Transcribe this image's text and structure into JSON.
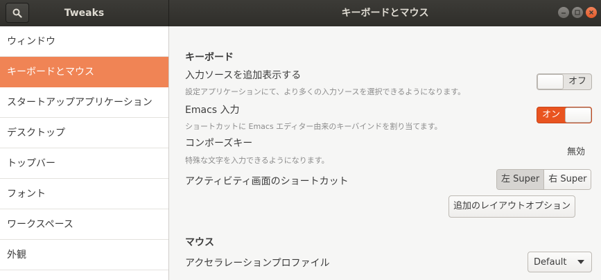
{
  "header": {
    "app_title": "Tweaks",
    "page_title": "キーボードとマウス"
  },
  "sidebar": {
    "items": [
      {
        "label": "ウィンドウ"
      },
      {
        "label": "キーボードとマウス"
      },
      {
        "label": "スタートアップアプリケーション"
      },
      {
        "label": "デスクトップ"
      },
      {
        "label": "トップバー"
      },
      {
        "label": "フォント"
      },
      {
        "label": "ワークスペース"
      },
      {
        "label": "外観"
      }
    ],
    "selected_index": 1
  },
  "keyboard": {
    "heading": "キーボード",
    "input_sources": {
      "label": "入力ソースを追加表示する",
      "desc": "設定アプリケーションにて、より多くの入力ソースを選択できるようになります。",
      "state": "オフ"
    },
    "emacs": {
      "label": "Emacs 入力",
      "desc": "ショートカットに Emacs エディター由来のキーバインドを割り当てます。",
      "state": "オン"
    },
    "compose": {
      "label": "コンポーズキー",
      "desc": "特殊な文字を入力できるようになります。",
      "value": "無効"
    },
    "overview": {
      "label": "アクティビティ画面のショートカット",
      "left": "左 Super",
      "right": "右 Super"
    },
    "layout_options_button": "追加のレイアウトオプション"
  },
  "mouse": {
    "heading": "マウス",
    "accel": {
      "label": "アクセラレーションプロファイル",
      "value": "Default"
    }
  },
  "colors": {
    "accent": "#e95420",
    "selection": "#f08455",
    "header": "#3c3b37"
  }
}
